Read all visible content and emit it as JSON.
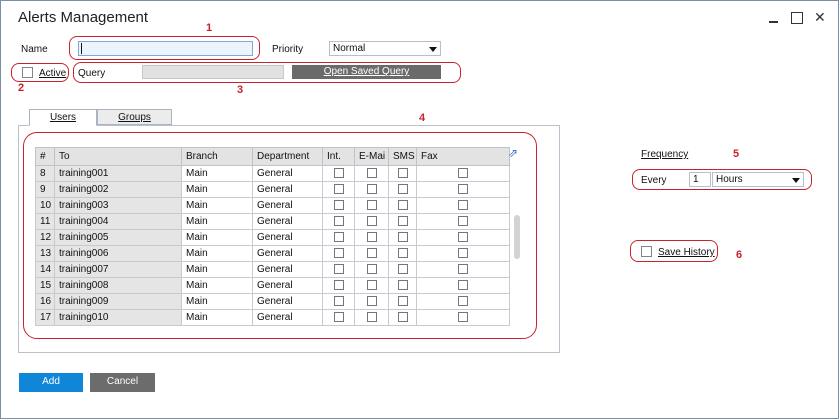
{
  "window": {
    "title": "Alerts Management"
  },
  "form": {
    "name_label": "Name",
    "name_value": "",
    "priority_label": "Priority",
    "priority_value": "Normal",
    "active_label": "Active",
    "query_label": "Query",
    "query_value": "",
    "open_saved_query_label": "Open Saved Query"
  },
  "tabs": [
    {
      "label": "Users",
      "active": true
    },
    {
      "label": "Groups",
      "active": false
    }
  ],
  "grid": {
    "columns": [
      "#",
      "To",
      "Branch",
      "Department",
      "Int.",
      "E-Mai",
      "SMS",
      "Fax"
    ],
    "rows": [
      {
        "num": "8",
        "to": "training001",
        "branch": "Main",
        "dept": "General"
      },
      {
        "num": "9",
        "to": "training002",
        "branch": "Main",
        "dept": "General"
      },
      {
        "num": "10",
        "to": "training003",
        "branch": "Main",
        "dept": "General"
      },
      {
        "num": "11",
        "to": "training004",
        "branch": "Main",
        "dept": "General"
      },
      {
        "num": "12",
        "to": "training005",
        "branch": "Main",
        "dept": "General"
      },
      {
        "num": "13",
        "to": "training006",
        "branch": "Main",
        "dept": "General"
      },
      {
        "num": "14",
        "to": "training007",
        "branch": "Main",
        "dept": "General"
      },
      {
        "num": "15",
        "to": "training008",
        "branch": "Main",
        "dept": "General"
      },
      {
        "num": "16",
        "to": "training009",
        "branch": "Main",
        "dept": "General"
      },
      {
        "num": "17",
        "to": "training010",
        "branch": "Main",
        "dept": "General"
      }
    ]
  },
  "frequency": {
    "label": "Frequency",
    "every_label": "Every",
    "every_value": "1",
    "unit_value": "Hours"
  },
  "save_history_label": "Save History",
  "buttons": {
    "add": "Add",
    "cancel": "Cancel"
  },
  "markers": [
    "1",
    "2",
    "3",
    "4",
    "5",
    "6"
  ],
  "colors": {
    "annotation": "#c8232c",
    "add_button": "#0f86d8",
    "cancel_button": "#6c6c6c"
  }
}
